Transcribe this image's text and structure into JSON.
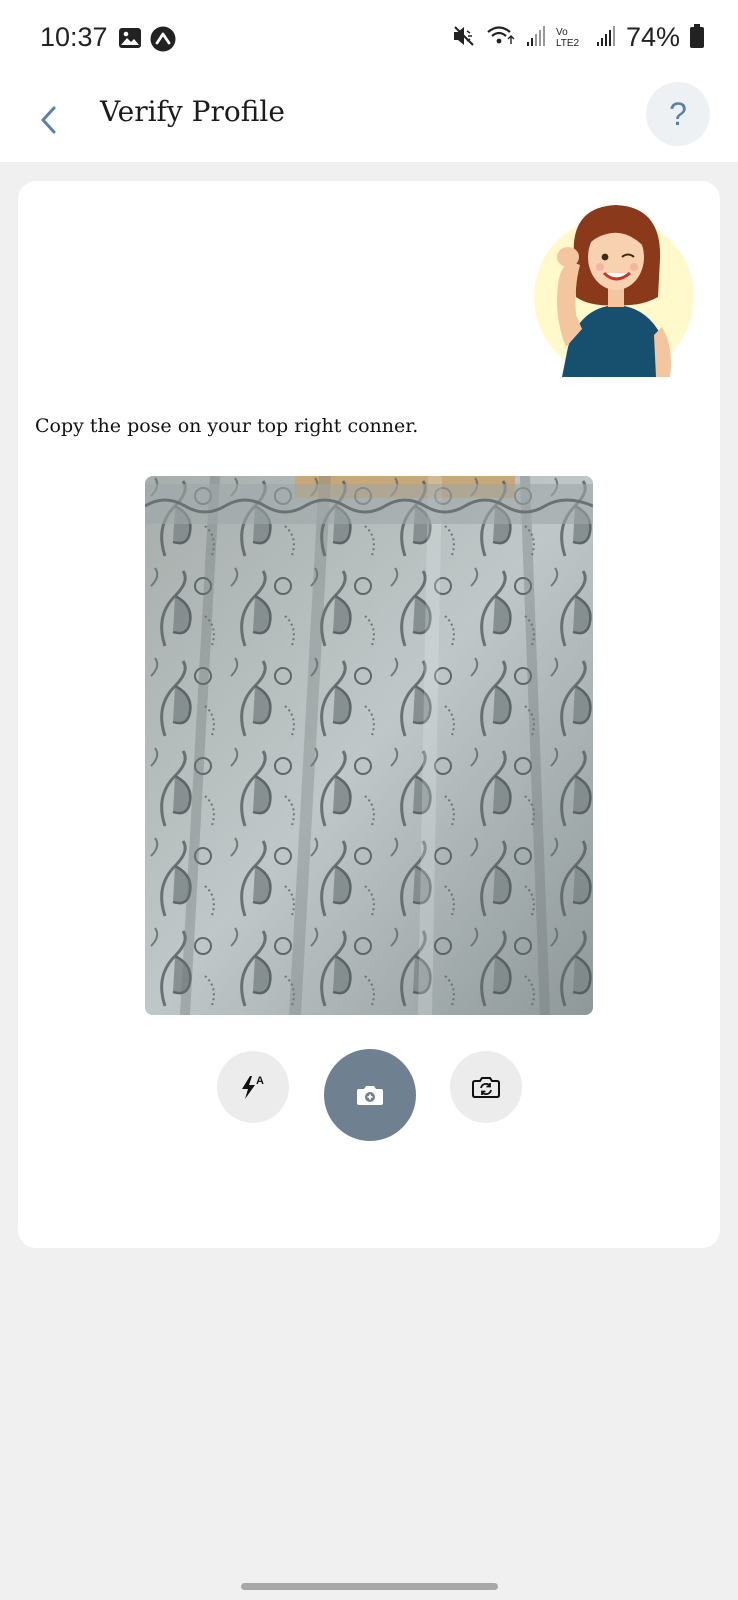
{
  "status_bar": {
    "time": "10:37",
    "battery": "74%",
    "network_label": "Vo LTE2",
    "icons": [
      "gallery-icon",
      "navigation-icon",
      "mute-icon",
      "wifi-icon",
      "signal-icon",
      "battery-icon"
    ]
  },
  "app_bar": {
    "title": "Verify Profile",
    "help_label": "?"
  },
  "main": {
    "instruction": "Copy the pose on your top right conner."
  },
  "controls": {
    "flash_icon": "flash-auto-icon",
    "capture_icon": "camera-capture-icon",
    "switch_icon": "switch-camera-icon"
  },
  "colors": {
    "accent": "#5b7fa8",
    "capture": "#6f8190",
    "background": "#f0f0f1"
  }
}
